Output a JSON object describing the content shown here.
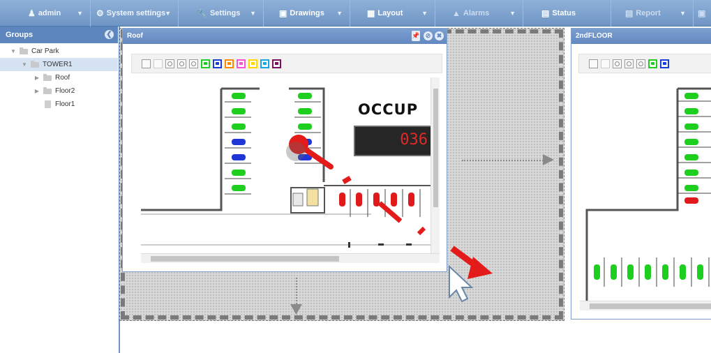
{
  "menu": {
    "items": [
      {
        "label": "admin",
        "icon": "user-icon"
      },
      {
        "label": "System settings",
        "icon": "gear-icon"
      },
      {
        "label": "Settings",
        "icon": "wrench-icon"
      },
      {
        "label": "Drawings",
        "icon": "image-icon"
      },
      {
        "label": "Layout",
        "icon": "layout-icon"
      },
      {
        "label": "Alarms",
        "icon": "warning-icon"
      },
      {
        "label": "Status",
        "icon": "chart-icon"
      },
      {
        "label": "Report",
        "icon": "report-icon"
      }
    ]
  },
  "groups": {
    "title": "Groups",
    "tree": [
      {
        "label": "Car Park",
        "level": 0,
        "type": "folder",
        "expanded": true
      },
      {
        "label": "TOWER1",
        "level": 1,
        "type": "folder",
        "expanded": true,
        "selected": true
      },
      {
        "label": "Roof",
        "level": 2,
        "type": "folder",
        "expanded": false
      },
      {
        "label": "Floor2",
        "level": 2,
        "type": "folder",
        "expanded": false
      },
      {
        "label": "Floor1",
        "level": 2,
        "type": "file"
      }
    ]
  },
  "windows": {
    "roof": {
      "title": "Roof",
      "occupancy_label": "OCCUP",
      "counter_value": "036"
    },
    "second_floor": {
      "title": "2ndFLOOR"
    }
  },
  "toolbar": {
    "flag_colors": [
      "#22cc22",
      "#1a3fd6",
      "#ff8a00",
      "#ff4fd8",
      "#ffd800",
      "#15a6e8",
      "#7a1060"
    ]
  },
  "colors": {
    "header": "#6389c0",
    "accent_red": "#e41b1b",
    "car_green": "#1fcf1f",
    "car_blue": "#1f35d6",
    "car_red": "#e01a1a"
  }
}
